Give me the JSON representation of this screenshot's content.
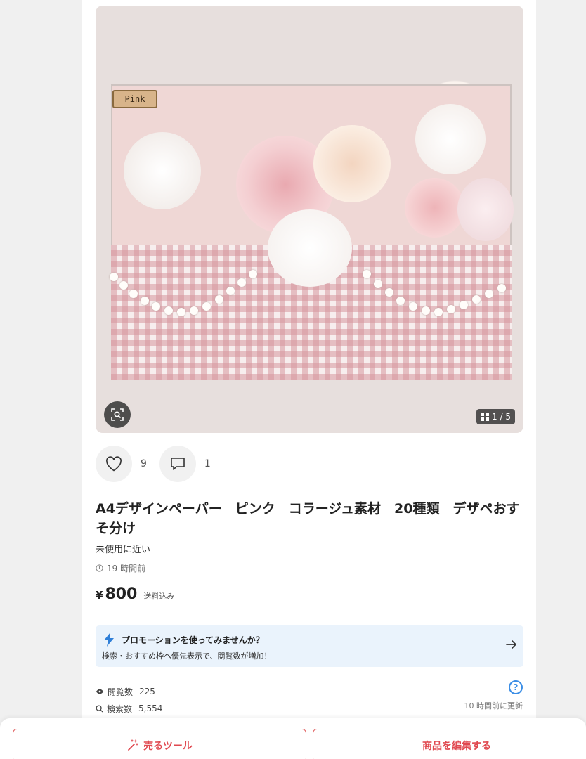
{
  "photo": {
    "tag_text": "Pink",
    "counter": "1 / 5"
  },
  "actions": {
    "like_count": "9",
    "comment_count": "1"
  },
  "item": {
    "title": "A4デザインペーパー　ピンク　コラージュ素材　20種類　デザペおすそ分け",
    "condition": "未使用に近い",
    "posted": "19 時間前",
    "currency": "¥",
    "price": "800",
    "shipping": "送料込み"
  },
  "promo": {
    "title": "プロモーションを使ってみませんか？",
    "description": "検索・おすすめ枠へ優先表示で、閲覧数が増加！"
  },
  "stats": {
    "views_label": "閲覧数",
    "views": "225",
    "searches_label": "検索数",
    "searches": "5,554",
    "updated": "10 時間前に更新"
  },
  "bottom": {
    "sell_tool": "売るツール",
    "edit_item": "商品を編集する"
  },
  "colors": {
    "accent_red": "#e0484f",
    "promo_bg": "#eaf3fc",
    "help_blue": "#3b8ee6"
  }
}
